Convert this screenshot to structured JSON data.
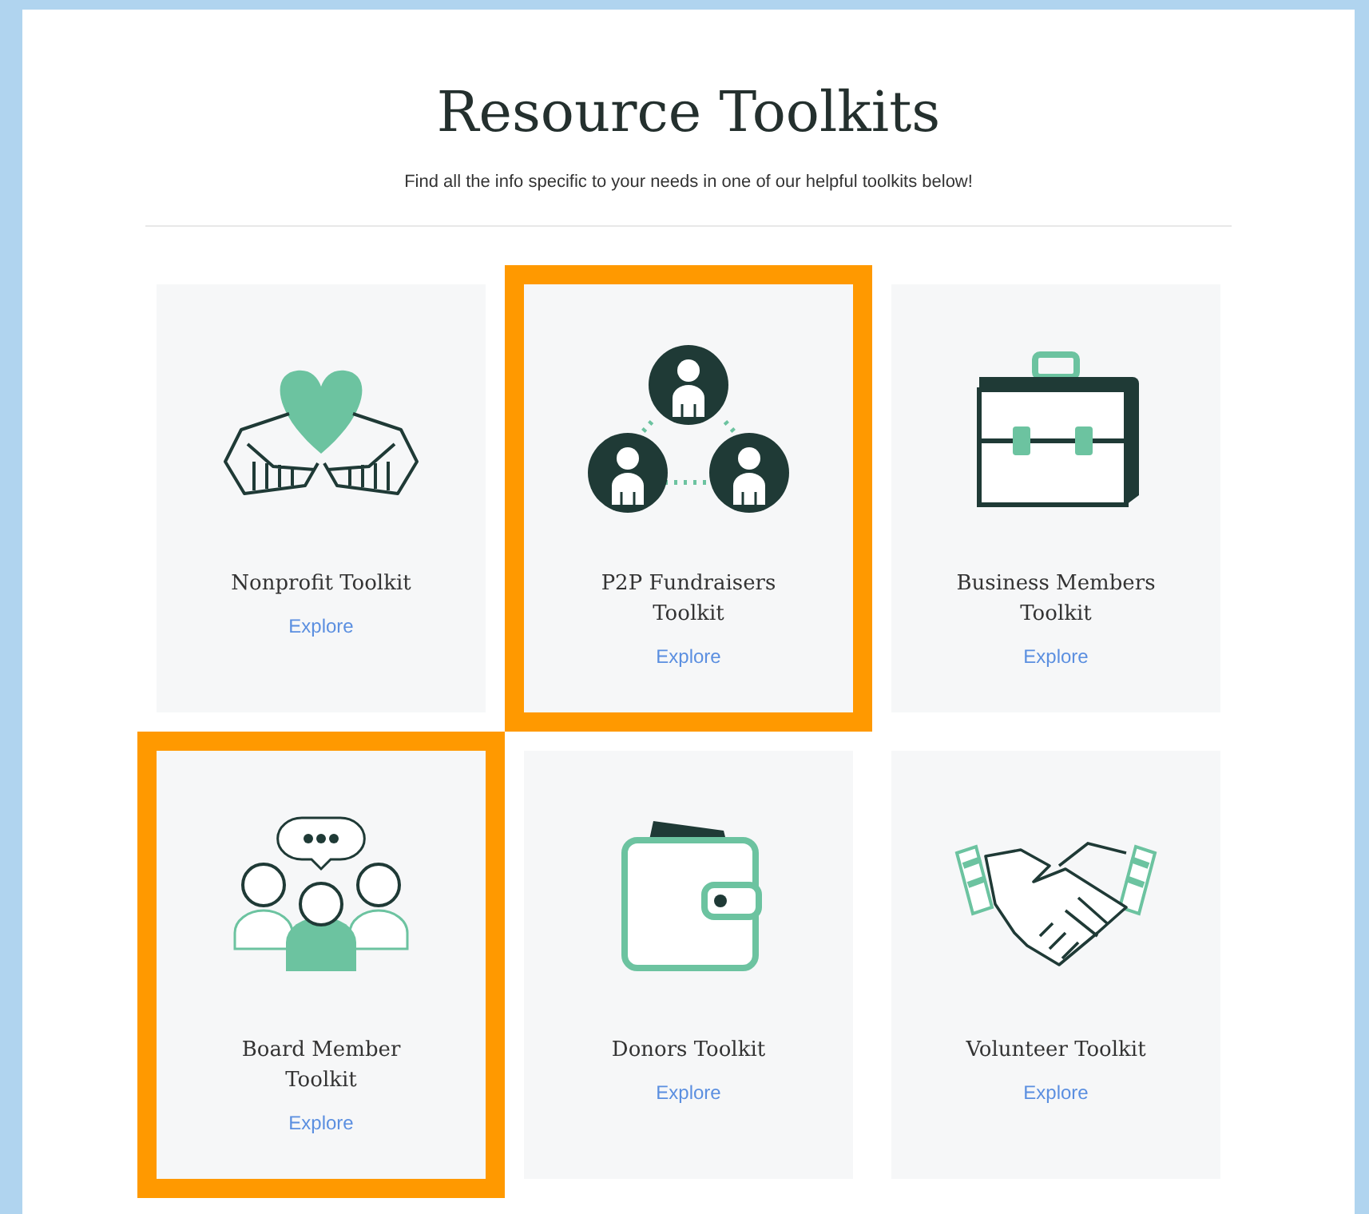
{
  "header": {
    "title": "Resource Toolkits",
    "subtitle": "Find all the info specific to your needs in one of our helpful toolkits below!"
  },
  "toolkits": [
    {
      "title": "Nonprofit Toolkit",
      "link": "Explore",
      "highlighted": false
    },
    {
      "title": "P2P Fundraisers Toolkit",
      "link": "Explore",
      "highlighted": true
    },
    {
      "title": "Business Members Toolkit",
      "link": "Explore",
      "highlighted": false
    },
    {
      "title": "Board Member Toolkit",
      "link": "Explore",
      "highlighted": true
    },
    {
      "title": "Donors Toolkit",
      "link": "Explore",
      "highlighted": false
    },
    {
      "title": "Volunteer Toolkit",
      "link": "Explore",
      "highlighted": false
    }
  ]
}
